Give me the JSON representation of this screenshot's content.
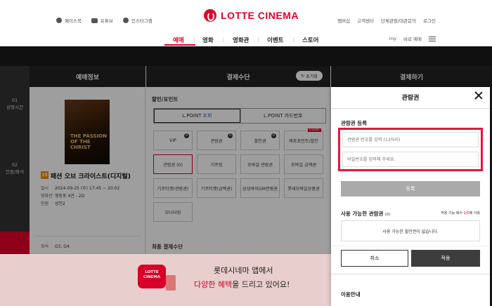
{
  "header": {
    "top_links": [
      "페이스북",
      "유튜브",
      "인스타그램"
    ],
    "logo_text": "LOTTE CINEMA",
    "util_links": [
      "멤버십",
      "고객센터",
      "단체관람/대관문의",
      "로그인"
    ],
    "nav": [
      "예매",
      "영화",
      "영화관",
      "이벤트",
      "스토어"
    ],
    "nav_right": [
      "my",
      "바로 예매"
    ]
  },
  "booking": {
    "col_info_title": "예매정보",
    "col_pay_title": "결제수단",
    "col_final_title": "결제하기",
    "reset_label": "초기화",
    "steps": [
      {
        "num": "01",
        "label": "상영시간"
      },
      {
        "num": "02",
        "label": "인원/좌석"
      }
    ],
    "movie": {
      "age": "15",
      "title": "패션 오브 크라이스트(디지털)",
      "poster_text": "THE PASSION OF THE CHRIST",
      "date_label": "일시",
      "date_value": "2024-09-25 (수) 17:45 ~ 20:02",
      "theater_label": "영화관",
      "theater_value": "영등포 4관 - 2D",
      "people_label": "인원",
      "people_value": "성인2",
      "seat_label": "좌석",
      "seat_value": "G3, G4"
    },
    "discount_label": "할인/포인트",
    "lpoint_tabs": {
      "tab1_prefix": "L.POINT",
      "tab1_suffix": "조회",
      "tab2": "L.POINT 카드번호"
    },
    "discount_cells": [
      "VIP",
      "관람권",
      "할인권",
      "제휴포인트/할인",
      "관람권 (0)",
      "기프팅",
      "모바일 관람권",
      "모바일 금액권",
      "기프티켓(관람권)",
      "기프티켓(금액권)",
      "삼성바이GM관람권",
      "롯데모바일상품권",
      "모니터링"
    ],
    "cell_badges": {
      "dot": "0",
      "event": "EVENT"
    },
    "final_pay_label": "최종 결제수단"
  },
  "banner": {
    "app_name": "LOTTE CINEMA",
    "line1": "롯데시네마 앱에서",
    "line2_hl": "다양한 혜택",
    "line2_rest": "을 드리고 있어요!"
  },
  "modal": {
    "title": "관람권",
    "register_label": "관람권 등록",
    "ticket_placeholder": "관람권 번호를 입력 (13자리)",
    "password_placeholder": "비밀번호를 입력해 주세요.",
    "register_button": "등록",
    "available_label": "사용 가능한 관람권",
    "available_count": "(0)",
    "apply_count_text": "적용 가능 매수",
    "apply_count_value": "2/0",
    "apply_count_suffix": "매 사용",
    "empty_text": "사용 가능한 할인권이 없습니다.",
    "cancel_button": "취소",
    "apply_button": "적용",
    "usage_label": "이용안내"
  },
  "colors": {
    "brand": "#e4002b",
    "highlight": "#e4163d"
  }
}
